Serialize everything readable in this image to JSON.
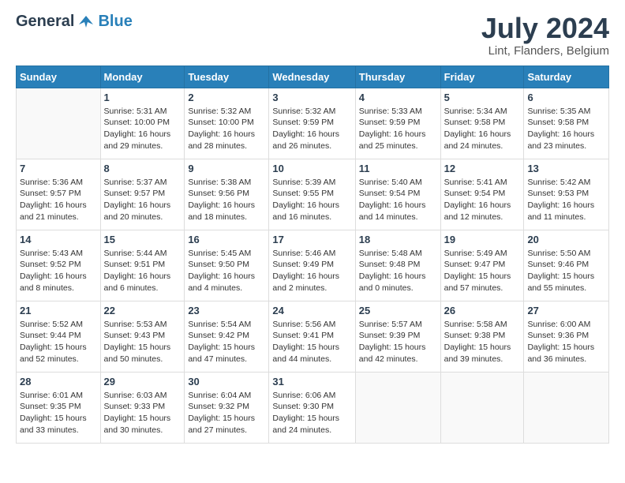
{
  "header": {
    "logo_general": "General",
    "logo_blue": "Blue",
    "month_title": "July 2024",
    "location": "Lint, Flanders, Belgium"
  },
  "calendar": {
    "weekdays": [
      "Sunday",
      "Monday",
      "Tuesday",
      "Wednesday",
      "Thursday",
      "Friday",
      "Saturday"
    ],
    "weeks": [
      [
        {
          "day": "",
          "info": ""
        },
        {
          "day": "1",
          "info": "Sunrise: 5:31 AM\nSunset: 10:00 PM\nDaylight: 16 hours\nand 29 minutes."
        },
        {
          "day": "2",
          "info": "Sunrise: 5:32 AM\nSunset: 10:00 PM\nDaylight: 16 hours\nand 28 minutes."
        },
        {
          "day": "3",
          "info": "Sunrise: 5:32 AM\nSunset: 9:59 PM\nDaylight: 16 hours\nand 26 minutes."
        },
        {
          "day": "4",
          "info": "Sunrise: 5:33 AM\nSunset: 9:59 PM\nDaylight: 16 hours\nand 25 minutes."
        },
        {
          "day": "5",
          "info": "Sunrise: 5:34 AM\nSunset: 9:58 PM\nDaylight: 16 hours\nand 24 minutes."
        },
        {
          "day": "6",
          "info": "Sunrise: 5:35 AM\nSunset: 9:58 PM\nDaylight: 16 hours\nand 23 minutes."
        }
      ],
      [
        {
          "day": "7",
          "info": "Sunrise: 5:36 AM\nSunset: 9:57 PM\nDaylight: 16 hours\nand 21 minutes."
        },
        {
          "day": "8",
          "info": "Sunrise: 5:37 AM\nSunset: 9:57 PM\nDaylight: 16 hours\nand 20 minutes."
        },
        {
          "day": "9",
          "info": "Sunrise: 5:38 AM\nSunset: 9:56 PM\nDaylight: 16 hours\nand 18 minutes."
        },
        {
          "day": "10",
          "info": "Sunrise: 5:39 AM\nSunset: 9:55 PM\nDaylight: 16 hours\nand 16 minutes."
        },
        {
          "day": "11",
          "info": "Sunrise: 5:40 AM\nSunset: 9:54 PM\nDaylight: 16 hours\nand 14 minutes."
        },
        {
          "day": "12",
          "info": "Sunrise: 5:41 AM\nSunset: 9:54 PM\nDaylight: 16 hours\nand 12 minutes."
        },
        {
          "day": "13",
          "info": "Sunrise: 5:42 AM\nSunset: 9:53 PM\nDaylight: 16 hours\nand 11 minutes."
        }
      ],
      [
        {
          "day": "14",
          "info": "Sunrise: 5:43 AM\nSunset: 9:52 PM\nDaylight: 16 hours\nand 8 minutes."
        },
        {
          "day": "15",
          "info": "Sunrise: 5:44 AM\nSunset: 9:51 PM\nDaylight: 16 hours\nand 6 minutes."
        },
        {
          "day": "16",
          "info": "Sunrise: 5:45 AM\nSunset: 9:50 PM\nDaylight: 16 hours\nand 4 minutes."
        },
        {
          "day": "17",
          "info": "Sunrise: 5:46 AM\nSunset: 9:49 PM\nDaylight: 16 hours\nand 2 minutes."
        },
        {
          "day": "18",
          "info": "Sunrise: 5:48 AM\nSunset: 9:48 PM\nDaylight: 16 hours\nand 0 minutes."
        },
        {
          "day": "19",
          "info": "Sunrise: 5:49 AM\nSunset: 9:47 PM\nDaylight: 15 hours\nand 57 minutes."
        },
        {
          "day": "20",
          "info": "Sunrise: 5:50 AM\nSunset: 9:46 PM\nDaylight: 15 hours\nand 55 minutes."
        }
      ],
      [
        {
          "day": "21",
          "info": "Sunrise: 5:52 AM\nSunset: 9:44 PM\nDaylight: 15 hours\nand 52 minutes."
        },
        {
          "day": "22",
          "info": "Sunrise: 5:53 AM\nSunset: 9:43 PM\nDaylight: 15 hours\nand 50 minutes."
        },
        {
          "day": "23",
          "info": "Sunrise: 5:54 AM\nSunset: 9:42 PM\nDaylight: 15 hours\nand 47 minutes."
        },
        {
          "day": "24",
          "info": "Sunrise: 5:56 AM\nSunset: 9:41 PM\nDaylight: 15 hours\nand 44 minutes."
        },
        {
          "day": "25",
          "info": "Sunrise: 5:57 AM\nSunset: 9:39 PM\nDaylight: 15 hours\nand 42 minutes."
        },
        {
          "day": "26",
          "info": "Sunrise: 5:58 AM\nSunset: 9:38 PM\nDaylight: 15 hours\nand 39 minutes."
        },
        {
          "day": "27",
          "info": "Sunrise: 6:00 AM\nSunset: 9:36 PM\nDaylight: 15 hours\nand 36 minutes."
        }
      ],
      [
        {
          "day": "28",
          "info": "Sunrise: 6:01 AM\nSunset: 9:35 PM\nDaylight: 15 hours\nand 33 minutes."
        },
        {
          "day": "29",
          "info": "Sunrise: 6:03 AM\nSunset: 9:33 PM\nDaylight: 15 hours\nand 30 minutes."
        },
        {
          "day": "30",
          "info": "Sunrise: 6:04 AM\nSunset: 9:32 PM\nDaylight: 15 hours\nand 27 minutes."
        },
        {
          "day": "31",
          "info": "Sunrise: 6:06 AM\nSunset: 9:30 PM\nDaylight: 15 hours\nand 24 minutes."
        },
        {
          "day": "",
          "info": ""
        },
        {
          "day": "",
          "info": ""
        },
        {
          "day": "",
          "info": ""
        }
      ]
    ]
  }
}
